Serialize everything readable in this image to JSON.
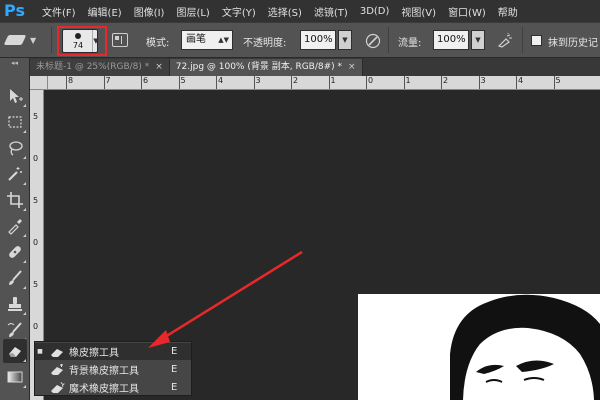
{
  "app": {
    "logo": "Ps"
  },
  "menu": [
    {
      "label": "文件(F)"
    },
    {
      "label": "编辑(E)"
    },
    {
      "label": "图像(I)"
    },
    {
      "label": "图层(L)"
    },
    {
      "label": "文字(Y)"
    },
    {
      "label": "选择(S)"
    },
    {
      "label": "滤镜(T)"
    },
    {
      "label": "3D(D)"
    },
    {
      "label": "视图(V)"
    },
    {
      "label": "窗口(W)"
    },
    {
      "label": "帮助"
    }
  ],
  "options": {
    "brush_size": "74",
    "mode_label": "模式:",
    "mode_value": "画笔",
    "opacity_label": "不透明度:",
    "opacity_value": "100%",
    "flow_label": "流量:",
    "flow_value": "100%",
    "erase_history_label": "抹到历史记"
  },
  "tabs": [
    {
      "label": "未标题-1 @ 25%(RGB/8) *",
      "close": "×",
      "active": false
    },
    {
      "label": "72.jpg @ 100% (背景 副本, RGB/8#) *",
      "close": "×",
      "active": true
    }
  ],
  "ruler_top": [
    "8",
    "7",
    "6",
    "5",
    "4",
    "3",
    "2",
    "1",
    "0",
    "1",
    "2",
    "3",
    "4",
    "5"
  ],
  "ruler_left": [
    "5",
    "0",
    "5",
    "0",
    "5",
    "0"
  ],
  "flyout": [
    {
      "bullet": "■",
      "label": "橡皮擦工具",
      "shortcut": "E",
      "selected": true
    },
    {
      "bullet": "",
      "label": "背景橡皮擦工具",
      "shortcut": "E",
      "selected": false
    },
    {
      "bullet": "",
      "label": "魔术橡皮擦工具",
      "shortcut": "E",
      "selected": false
    }
  ],
  "colors": {
    "highlight_red": "#e8282b",
    "ps_blue": "#31a8ff"
  }
}
